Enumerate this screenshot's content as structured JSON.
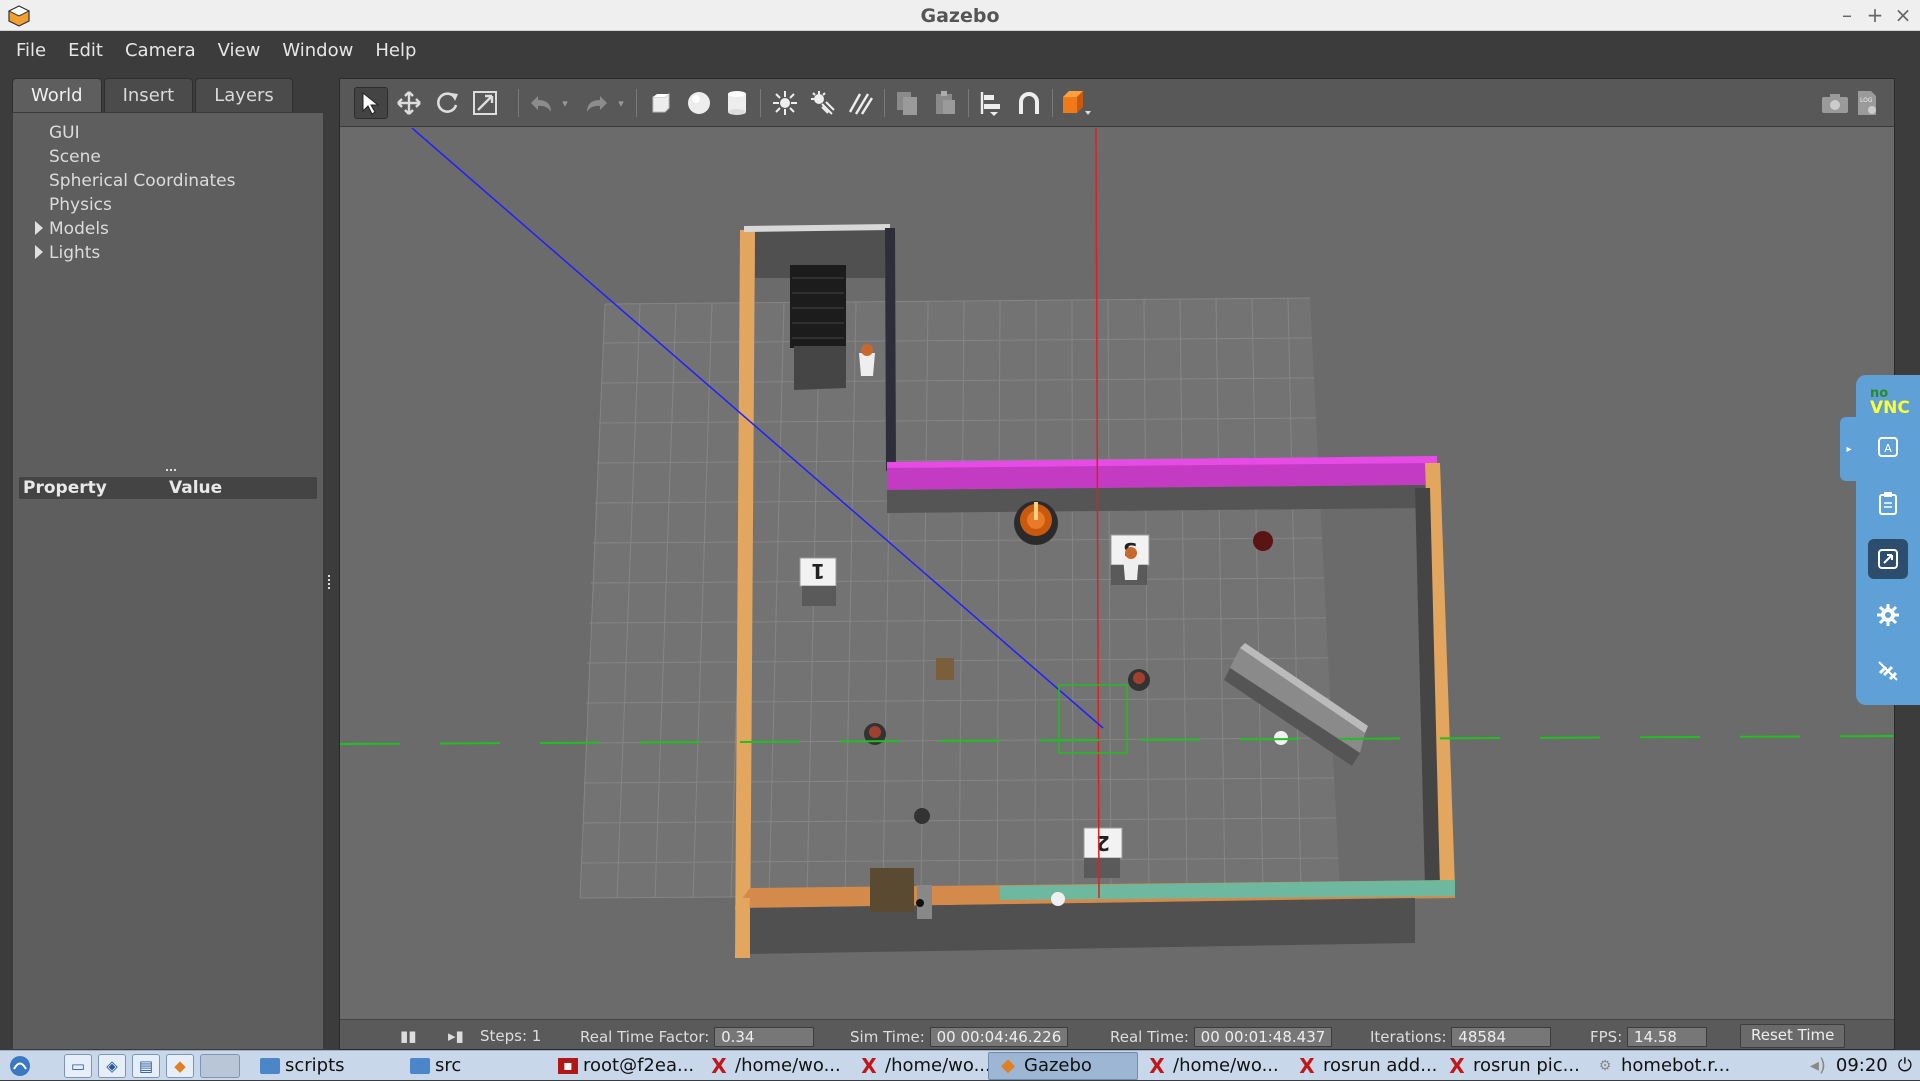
{
  "window": {
    "title": "Gazebo",
    "minimize": "–",
    "maximize": "+",
    "close": "×"
  },
  "menubar": [
    "File",
    "Edit",
    "Camera",
    "View",
    "Window",
    "Help"
  ],
  "left_panel": {
    "tabs": [
      "World",
      "Insert",
      "Layers"
    ],
    "active_tab": "World",
    "tree": [
      {
        "label": "GUI",
        "expandable": false
      },
      {
        "label": "Scene",
        "expandable": false
      },
      {
        "label": "Spherical Coordinates",
        "expandable": false
      },
      {
        "label": "Physics",
        "expandable": false
      },
      {
        "label": "Models",
        "expandable": true
      },
      {
        "label": "Lights",
        "expandable": true
      }
    ],
    "property_header": {
      "property": "Property",
      "value": "Value"
    }
  },
  "toolbar": {
    "icons": [
      "select-arrow-icon",
      "translate-icon",
      "rotate-icon",
      "scale-icon",
      "undo-icon",
      "undo-dropdown-icon",
      "redo-icon",
      "redo-dropdown-icon",
      "box-shape-icon",
      "sphere-shape-icon",
      "cylinder-shape-icon",
      "point-light-icon",
      "spot-light-icon",
      "directional-light-icon",
      "copy-icon",
      "paste-icon",
      "align-icon",
      "snap-icon",
      "view-angle-icon",
      "screenshot-icon",
      "log-icon"
    ],
    "selected": "select-arrow-icon"
  },
  "scene": {
    "markers": [
      "1",
      "2",
      "3"
    ],
    "colors": {
      "floor_wall": "#e3a65f",
      "magenta_wall": "#d63ad6",
      "teal_wall": "#6fb8a0",
      "grid": "#8a8a8a",
      "x_axis": "#e02020",
      "y_axis": "#20c020",
      "blue_ray": "#2020ff"
    }
  },
  "statusbar": {
    "steps_label": "Steps: 1",
    "rtf_label": "Real Time Factor:",
    "rtf_value": "0.34",
    "sim_time_label": "Sim Time:",
    "sim_time_value": "00 00:04:46.226",
    "real_time_label": "Real Time:",
    "real_time_value": "00 00:01:48.437",
    "iterations_label": "Iterations:",
    "iterations_value": "48584",
    "fps_label": "FPS:",
    "fps_value": "14.58",
    "reset_time": "Reset Time"
  },
  "novnc": {
    "logo_top": "no",
    "logo_bottom": "VNC",
    "buttons": [
      "keyboard-icon",
      "clipboard-icon",
      "fullscreen-icon",
      "settings-icon",
      "disconnect-icon"
    ]
  },
  "taskbar": {
    "tasks": [
      {
        "label": "scripts",
        "icon": "folder-icon"
      },
      {
        "label": "src",
        "icon": "folder-icon"
      },
      {
        "label": "root@f2ea...",
        "icon": "terminal-icon"
      },
      {
        "label": "/home/wo...",
        "icon": "xterm-icon"
      },
      {
        "label": "/home/wo...",
        "icon": "xterm-icon"
      },
      {
        "label": "Gazebo",
        "icon": "gazebo-icon",
        "active": true
      },
      {
        "label": "/home/wo...",
        "icon": "xterm-icon"
      },
      {
        "label": "rosrun add...",
        "icon": "xterm-icon"
      },
      {
        "label": "rosrun pic...",
        "icon": "xterm-icon"
      },
      {
        "label": "homebot.r...",
        "icon": "app-icon"
      }
    ],
    "clock": "09:20"
  }
}
